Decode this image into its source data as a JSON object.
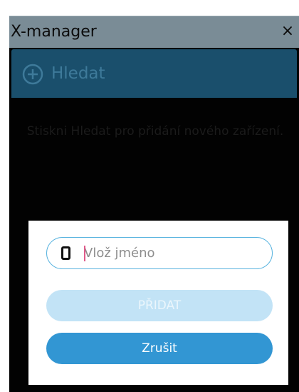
{
  "window": {
    "title": "X-manager",
    "close_glyph": "×"
  },
  "search": {
    "icon": "plus-circle-icon",
    "label": "Hledat"
  },
  "hint": "Stiskni Hledat pro přidání nového zařízení.",
  "dialog": {
    "name_field": {
      "icon": "phone-icon",
      "placeholder": "Vlož jméno",
      "value": ""
    },
    "add_label": "PŘIDAT",
    "cancel_label": "Zrušit"
  },
  "colors": {
    "titlebar": "#7a8c96",
    "searchbar": "#1a4f6c",
    "accent": "#3296d3",
    "disabled": "#c2e3f6",
    "field_border": "#58b3df"
  }
}
